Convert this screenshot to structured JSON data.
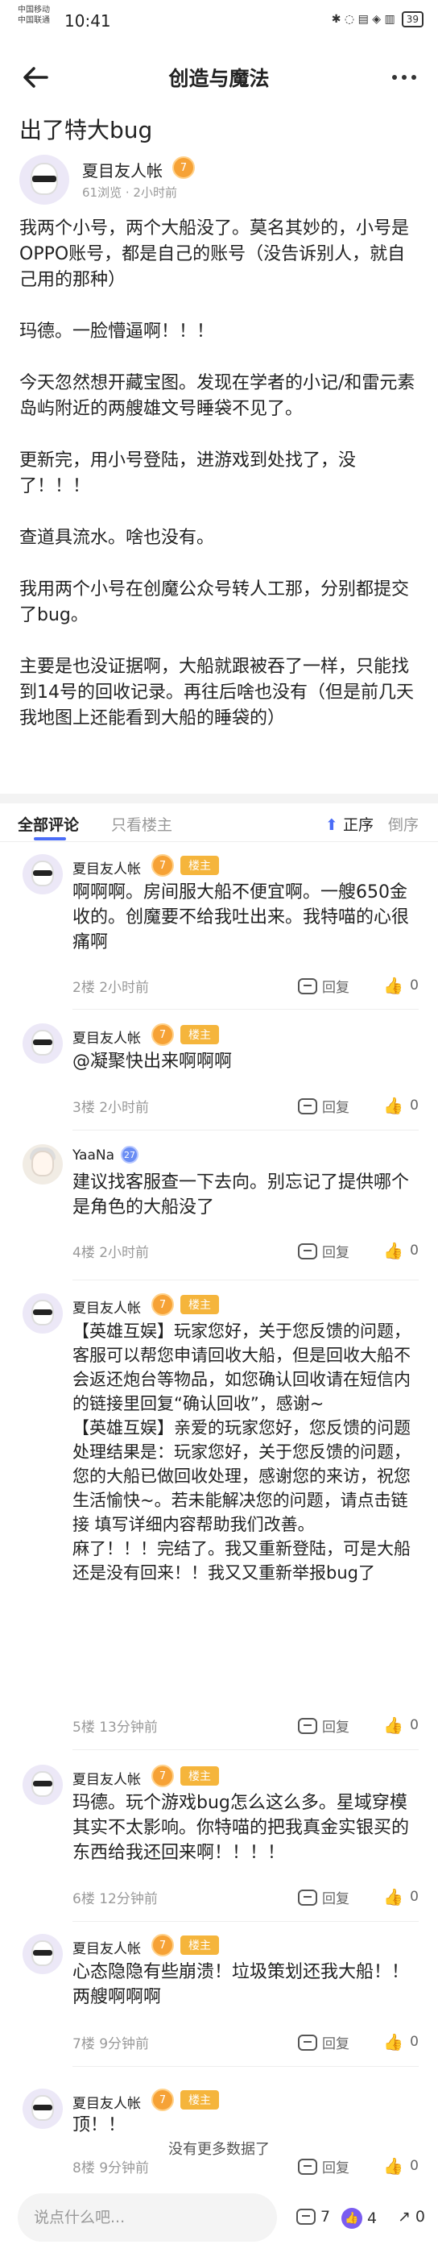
{
  "status": {
    "carrier1": "中国移动",
    "carrier2": "中国联通",
    "time": "10:41",
    "icons": "✱ ◌ ▤ ◈ ▥",
    "battery": "39"
  },
  "header": {
    "title": "创造与魔法"
  },
  "post": {
    "title": "出了特大bug",
    "author": "夏目友人帐",
    "level": "7",
    "views": "61浏览",
    "time": "2小时前",
    "paragraphs": [
      "我两个小号，两个大船没了。莫名其妙的，小号是OPPO账号，都是自己的账号（没告诉别人，就自己用的那种）",
      "玛德。一脸懵逼啊！！！",
      "今天忽然想开藏宝图。发现在学者的小记/和雷元素岛屿附近的两艘雄文号睡袋不见了。",
      "更新完，用小号登陆，进游戏到处找了，没了！！！",
      "查道具流水。啥也没有。",
      "我用两个小号在创魔公众号转人工那，分别都提交了bug。",
      "主要是也没证据啊，大船就跟被吞了一样，只能找到14号的回收记录。再往后啥也没有（但是前几天我地图上还能看到大船的睡袋的）"
    ]
  },
  "tabs": {
    "all": "全部评论",
    "owner": "只看楼主",
    "asc": "正序",
    "desc": "倒序"
  },
  "owner_label": "楼主",
  "reply_label": "回复",
  "comments": [
    {
      "name": "夏目友人帐",
      "level": "7",
      "text": "啊啊啊。房间服大船不便宜啊。一艘650金收的。创魔要不给我吐出来。我特喵的心很痛啊",
      "floor": "2楼",
      "time": "2小时前",
      "likes": "0"
    },
    {
      "name": "夏目友人帐",
      "level": "7",
      "text": "@凝聚快出来啊啊啊",
      "floor": "3楼",
      "time": "2小时前",
      "likes": "0"
    },
    {
      "name": "YaaNa",
      "level": "27",
      "text": "建议找客服查一下去向。别忘记了提供哪个是角色的大船没了",
      "floor": "4楼",
      "time": "2小时前",
      "likes": "0"
    },
    {
      "name": "夏目友人帐",
      "level": "7",
      "text": "【英雄互娱】玩家您好，关于您反馈的问题，客服可以帮您申请回收大船，但是回收大船不会返还炮台等物品，如您确认回收请在短信内的链接里回复“确认回收”，感谢~\n【英雄互娱】亲爱的玩家您好，您反馈的问题处理结果是：玩家您好，关于您反馈的问题，您的大船已做回收处理，感谢您的来访，祝您生活愉快~。若未能解决您的问题，请点击链接 填写详细内容帮助我们改善。\n麻了！！！完结了。我又重新登陆，可是大船还是没有回来！！我又又重新举报bug了",
      "floor": "5楼",
      "time": "13分钟前",
      "likes": "0"
    },
    {
      "name": "夏目友人帐",
      "level": "7",
      "text": "玛德。玩个游戏bug怎么这么多。星域穿模其实不太影响。你特喵的把我真金实银买的东西给我还回来啊！！！！",
      "floor": "6楼",
      "time": "12分钟前",
      "likes": "0"
    },
    {
      "name": "夏目友人帐",
      "level": "7",
      "text": "心态隐隐有些崩溃！垃圾策划还我大船！！两艘啊啊啊",
      "floor": "7楼",
      "time": "9分钟前",
      "likes": "0"
    },
    {
      "name": "夏目友人帐",
      "level": "7",
      "text": "顶！！",
      "floor": "8楼",
      "time": "9分钟前",
      "likes": "0"
    }
  ],
  "footer": {
    "no_more": "没有更多数据了",
    "placeholder": "说点什么吧...",
    "comment_count": "7",
    "like_count": "4",
    "share_count": "0"
  }
}
